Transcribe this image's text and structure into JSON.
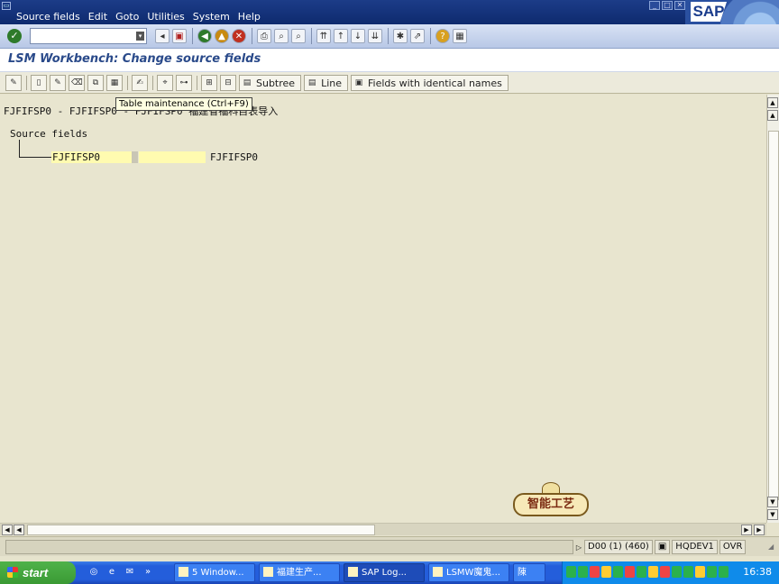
{
  "window": {
    "menus": [
      "Source fields",
      "Edit",
      "Goto",
      "Utilities",
      "System",
      "Help"
    ],
    "brand": "SAP"
  },
  "toolbar": {
    "command_value": ""
  },
  "title": "LSM Workbench: Change source fields",
  "app_toolbar": {
    "subtree_label": "Subtree",
    "line_label": "Line",
    "identical_label": "Fields with identical names"
  },
  "tooltip": "Table maintenance    (Ctrl+F9)",
  "content": {
    "header": "FJFIFSP0 - FJFIFSP0 - FJFIFSP0 福建省福科目表导入",
    "source_fields_label": "Source fields",
    "node_name": "FJFIFSP0",
    "node_structure": "FJFIFSP0"
  },
  "watermark": "智能工艺",
  "status": {
    "session": "D00 (1) (460)",
    "server": "HQDEV1",
    "mode": "OVR"
  },
  "taskbar": {
    "start_label": "start",
    "tasks": [
      "5 Window...",
      "福建生产...",
      "SAP Log...",
      "LSMW魔鬼...",
      "陳"
    ],
    "clock": "16:38"
  }
}
